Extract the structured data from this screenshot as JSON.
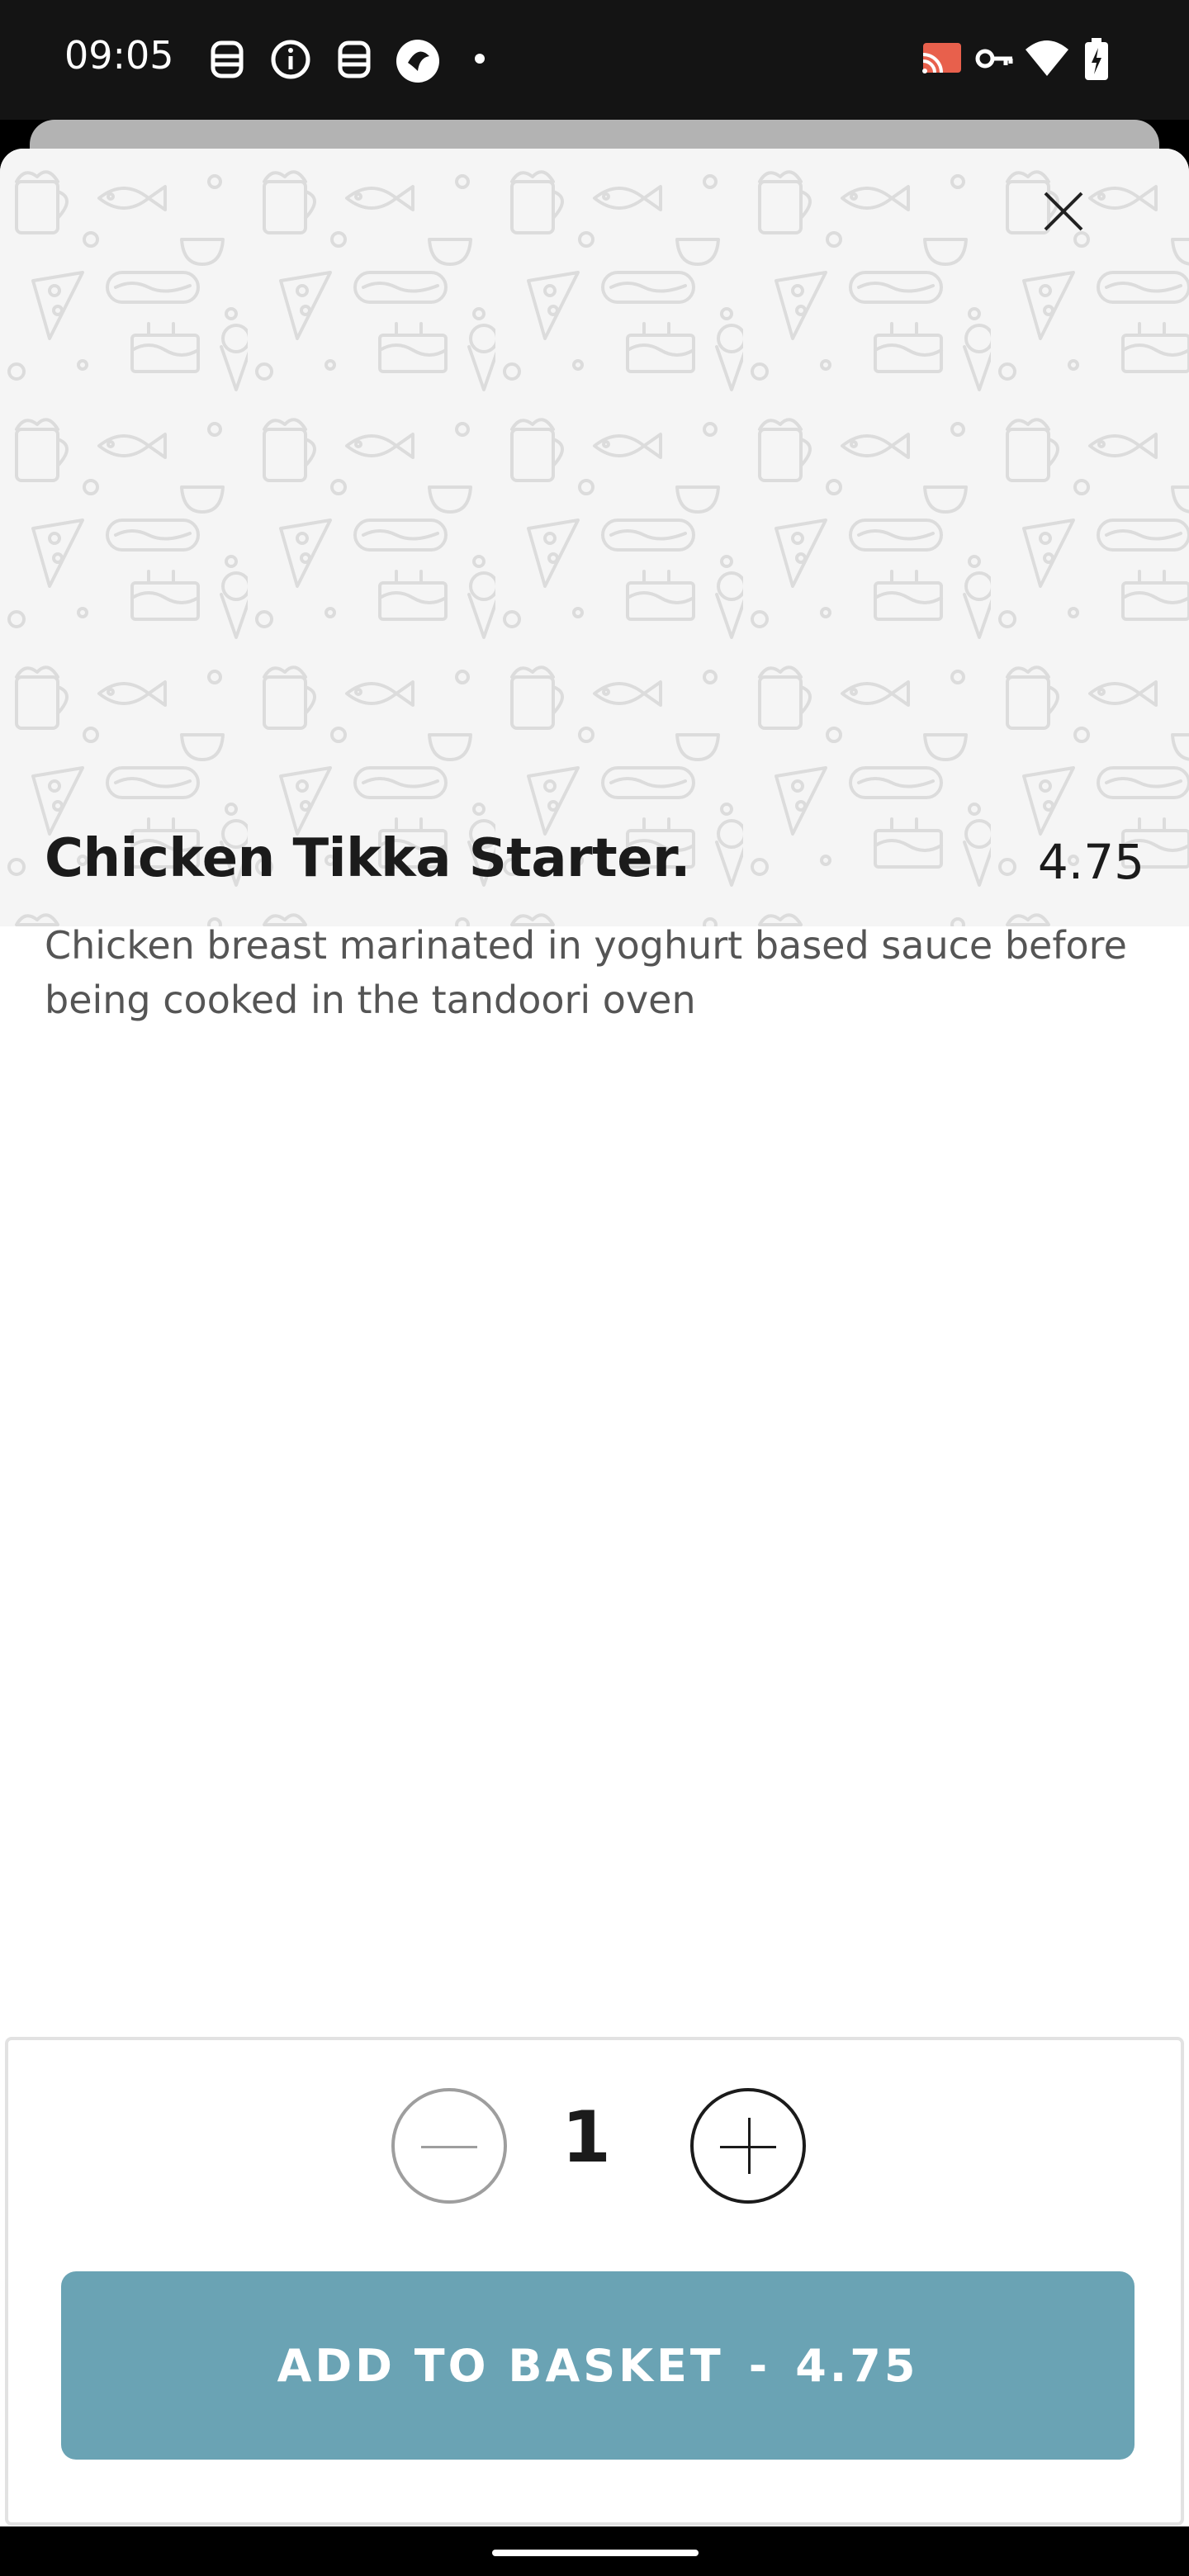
{
  "status_bar": {
    "time": "09:05",
    "left_icons": [
      "notification-icon",
      "info-icon",
      "notification-icon",
      "app-icon",
      "dot-icon"
    ],
    "right_icons": [
      "cast-icon",
      "key-icon",
      "wifi-icon",
      "battery-charging-icon"
    ]
  },
  "item": {
    "title": "Chicken Tikka Starter.",
    "price": "4.75",
    "description": "Chicken breast marinated in yoghurt based sauce before being cooked in the tandoori oven",
    "hero_pattern": "food-doodle-pattern"
  },
  "quantity": {
    "value": "1",
    "decrease_icon": "minus-icon",
    "increase_icon": "plus-icon"
  },
  "add_button": {
    "label": "ADD TO BASKET",
    "separator": "-",
    "price": "4.75"
  },
  "colors": {
    "accent": "#6aa3b4",
    "status_bar": "#141414",
    "hero_bg": "#f5f5f5"
  }
}
